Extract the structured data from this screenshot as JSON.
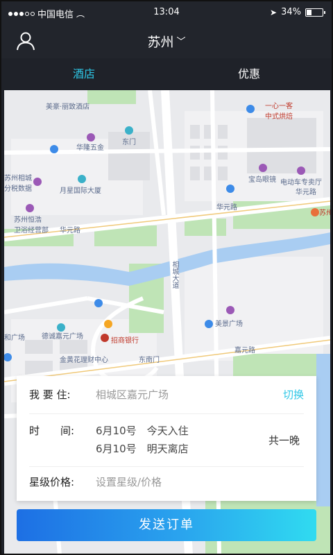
{
  "status_bar": {
    "carrier": "中国电信",
    "time": "13:04",
    "battery": "34%",
    "battery_level": 0.34
  },
  "header": {
    "city": "苏州"
  },
  "tabs": [
    {
      "label": "酒店"
    },
    {
      "label": "优惠"
    }
  ],
  "map": {
    "pois": {
      "p1": "美豪·丽致酒店",
      "p2": "华隆五金",
      "p3": "东门",
      "p4": "苏州相城\n分税数据",
      "p5": "月星国际大厦",
      "p6": "苏州恒浩\n卫浴经营部",
      "p7": "一心一客\n中式烘焙",
      "p8": "宝岛眼镜",
      "p9": "电动车专卖厅",
      "p10": "华元路",
      "p11": "华元路",
      "p12": "华元路",
      "p13": "相城大道",
      "p14": "美景广场",
      "p15": "德诚嘉元广场",
      "p16": "招商银行",
      "p17": "和广场",
      "p18": "嘉元路",
      "p19": "金黄花理财中心",
      "p20": "东南门",
      "p21": "苏州"
    }
  },
  "form": {
    "destination_label": "我 要 住:",
    "destination_value": "相城区嘉元广场",
    "switch_label": "切换",
    "time_label": "时　　间:",
    "checkin": "6月10号　今天入住",
    "checkout": "6月10号　明天离店",
    "nights": "共一晚",
    "price_label": "星级价格:",
    "price_placeholder": "设置星级/价格"
  },
  "submit_label": "发送订单"
}
